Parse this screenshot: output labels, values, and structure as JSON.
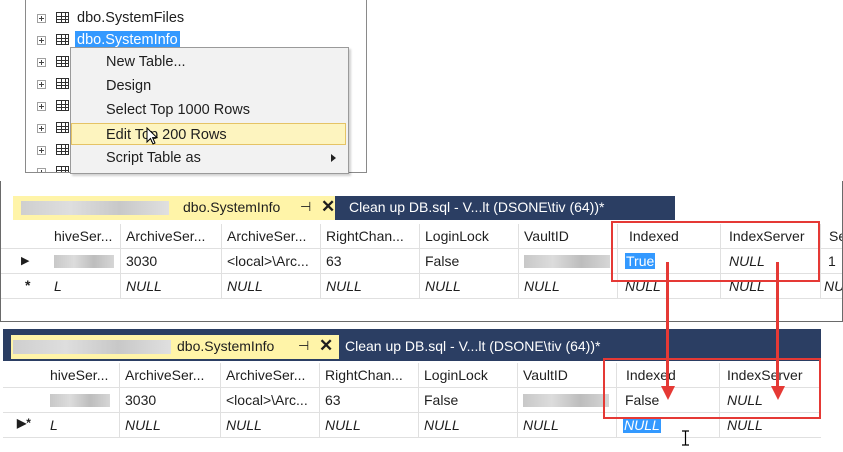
{
  "object_explorer": {
    "items": [
      {
        "label": "dbo.SystemFiles",
        "selected": false
      },
      {
        "label": "dbo.SystemInfo",
        "selected": true
      }
    ]
  },
  "context_menu": {
    "items": [
      {
        "label": "New Table...",
        "highlighted": false,
        "submenu": false
      },
      {
        "label": "Design",
        "highlighted": false,
        "submenu": false
      },
      {
        "label": "Select Top 1000 Rows",
        "highlighted": false,
        "submenu": false
      },
      {
        "label": "Edit Top 200 Rows",
        "highlighted": true,
        "submenu": false
      },
      {
        "label": "Script Table as",
        "highlighted": false,
        "submenu": true
      }
    ]
  },
  "tabs": {
    "active_title": "dbo.SystemInfo",
    "pin_glyph": "⊣",
    "close_glyph": "✕",
    "inactive_title": "Clean up DB.sql - V...lt (DSONE\\tiv (64))*"
  },
  "grid_top": {
    "columns": [
      "hiveSer...",
      "ArchiveSer...",
      "ArchiveSer...",
      "RightChan...",
      "LoginLock",
      "VaultID",
      "Indexed",
      "IndexServer",
      "Se"
    ],
    "row1": {
      "marker": "▶",
      "col2": "3030",
      "col3": "<local>\\Arc...",
      "col4": "63",
      "col5": "False",
      "col7": "True",
      "col8": "NULL",
      "col9": "1"
    },
    "row2": {
      "marker": "*",
      "col1": "L",
      "col2": "NULL",
      "col3": "NULL",
      "col4": "NULL",
      "col5": "NULL",
      "col6": "NULL",
      "col7": "NULL",
      "col8": "NULL",
      "col9": "NU"
    }
  },
  "grid_bottom": {
    "columns": [
      "hiveSer...",
      "ArchiveSer...",
      "ArchiveSer...",
      "RightChan...",
      "LoginLock",
      "VaultID",
      "Indexed",
      "IndexServer"
    ],
    "row1": {
      "col2": "3030",
      "col3": "<local>\\Arc...",
      "col4": "63",
      "col5": "False",
      "col7": "False",
      "col8": "NULL"
    },
    "row2": {
      "marker": "▶*",
      "col1": "L",
      "col2": "NULL",
      "col3": "NULL",
      "col4": "NULL",
      "col5": "NULL",
      "col6": "NULL",
      "col7": "NULL",
      "col8": "NULL"
    }
  },
  "colors": {
    "highlight_red": "#e53935",
    "tab_strip": "#2b3e63",
    "active_tab": "#fff4a8",
    "selection": "#3399ff"
  }
}
